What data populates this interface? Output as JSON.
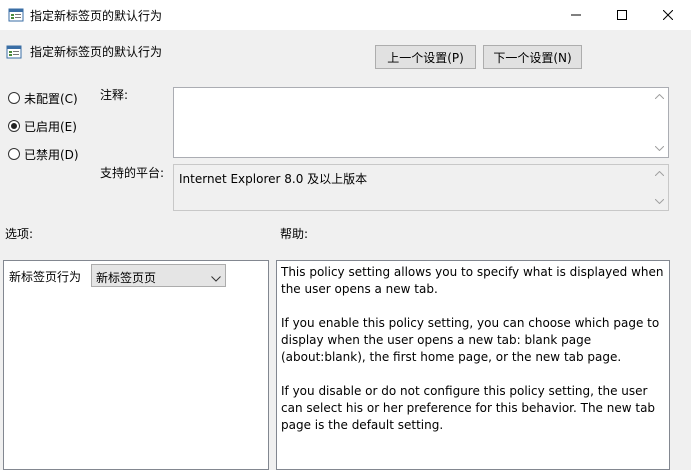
{
  "window": {
    "title": "指定新标签页的默认行为"
  },
  "header": {
    "title": "指定新标签页的默认行为",
    "prev_label": "上一个设置(P)",
    "next_label": "下一个设置(N)"
  },
  "state": {
    "options": [
      {
        "label": "未配置(C)",
        "checked": false
      },
      {
        "label": "已启用(E)",
        "checked": true
      },
      {
        "label": "已禁用(D)",
        "checked": false
      }
    ]
  },
  "comment": {
    "label": "注释:",
    "value": ""
  },
  "platform": {
    "label": "支持的平台:",
    "value": "Internet Explorer 8.0 及以上版本"
  },
  "options_section": {
    "label": "选项:",
    "field_label": "新标签页行为",
    "selected_value": "新标签页页"
  },
  "help_section": {
    "label": "帮助:",
    "paragraphs": [
      "This policy setting allows you to specify what is displayed when the user opens a new tab.",
      "If you enable this policy setting, you can choose which page to display when the user opens a new tab: blank page (about:blank), the first home page, or the new tab page.",
      "If you disable or do not configure this policy setting, the user can select his or her preference for this behavior. The new tab page is the default setting."
    ]
  },
  "icons": {
    "app": "policy-icon",
    "minimize": "minimize-icon",
    "maximize": "maximize-icon",
    "close": "close-icon",
    "dropdown": "chevron-down-icon"
  }
}
